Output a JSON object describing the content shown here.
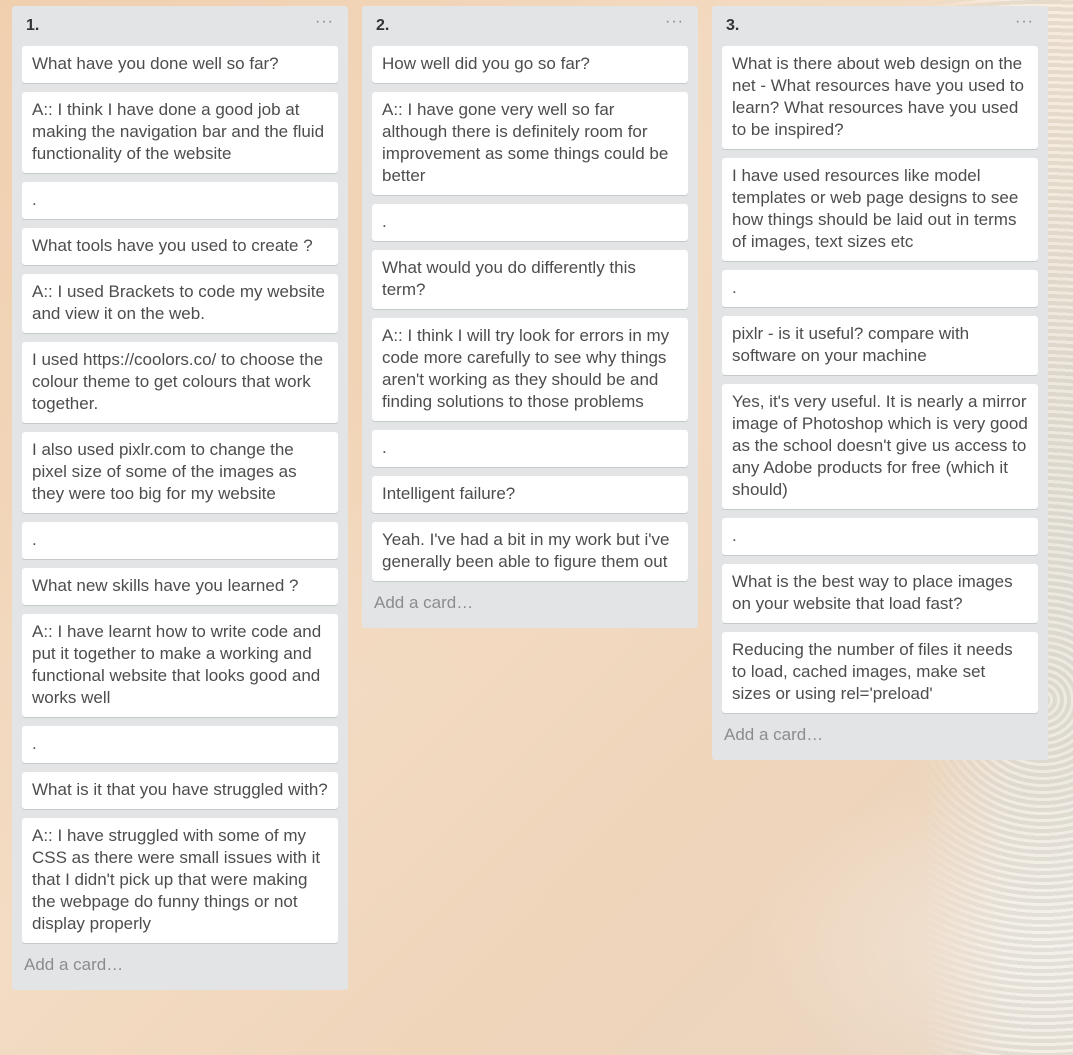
{
  "lists": [
    {
      "title": "1.",
      "menu": "···",
      "add_card": "Add a card…",
      "cards": [
        "What have you done well so far?",
        "A:: I think I have done a good job at making the navigation bar and the fluid functionality of the website",
        ".",
        "What tools have you used to create ?",
        "A:: I used Brackets to code my website and view it on the web.",
        "I used https://coolors.co/ to choose the colour theme to get colours that work together.",
        "I also used pixlr.com to change the pixel size of some of the images as they were too big for my website",
        ".",
        "What new skills have you learned ?",
        "A:: I have learnt how to write code and put it together to make a working and functional website that looks good and works well",
        ".",
        "What is it that you have struggled with?",
        "A:: I have struggled with some of my CSS as there were small issues with it that I didn't pick up that were making the webpage do funny things or not display properly"
      ]
    },
    {
      "title": "2.",
      "menu": "···",
      "add_card": "Add a card…",
      "cards": [
        "How well did you go so far?",
        "A:: I have gone very well so far although there is definitely room for improvement as some things could be better",
        ".",
        "What would you do differently this term?",
        "A:: I think I will try look for errors in my code more carefully to see why things aren't working as they should be and finding solutions to those problems",
        ".",
        "Intelligent failure?",
        "Yeah. I've had a bit in my work but i've generally been able to figure them out"
      ]
    },
    {
      "title": "3.",
      "menu": "···",
      "add_card": "Add a card…",
      "cards": [
        "What is there about web design on the net - What resources have you used to learn? What resources have you used to be inspired?",
        "I have used resources like model templates or web page designs to see how things should be laid out in terms of images, text sizes etc",
        ".",
        "pixlr - is it useful? compare with software on your machine",
        "Yes, it's very useful. It is nearly a mirror image of Photoshop which is very good as the school doesn't give us access to any Adobe products for free (which it should)",
        ".",
        "What is the best way to place images on your website that load fast?",
        "Reducing the number of files it needs to load, cached images, make set sizes or using rel='preload'"
      ]
    }
  ]
}
